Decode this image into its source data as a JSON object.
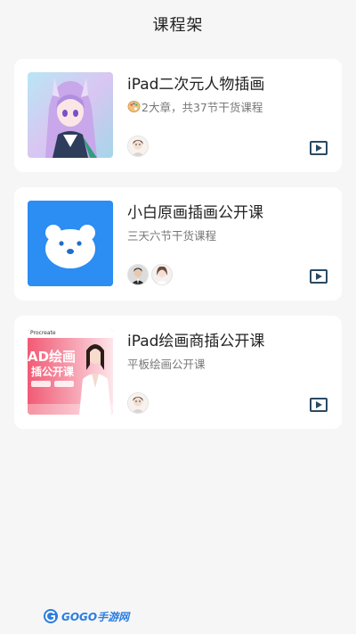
{
  "header": {
    "title": "课程架"
  },
  "courses": [
    {
      "title": "iPad二次元人物插画",
      "subtitle": "2大章，共37节干货课程",
      "icon": "palette-emoji",
      "teachers": 1
    },
    {
      "title": "小白原画插画公开课",
      "subtitle": "三天六节干货课程",
      "teachers": 2
    },
    {
      "title": "iPad绘画商插公开课",
      "subtitle": "平板绘画公开课",
      "teachers": 1,
      "thumbnail_texts": {
        "brand": "Procreate",
        "line1": "AD绘画",
        "line2": "插公开课"
      }
    }
  ],
  "watermark": {
    "text": "GOGO手游网"
  },
  "colors": {
    "play_icon": "#2a4a63",
    "bear_bg": "#2c8df2",
    "promo_bg": "#ef4d67"
  }
}
